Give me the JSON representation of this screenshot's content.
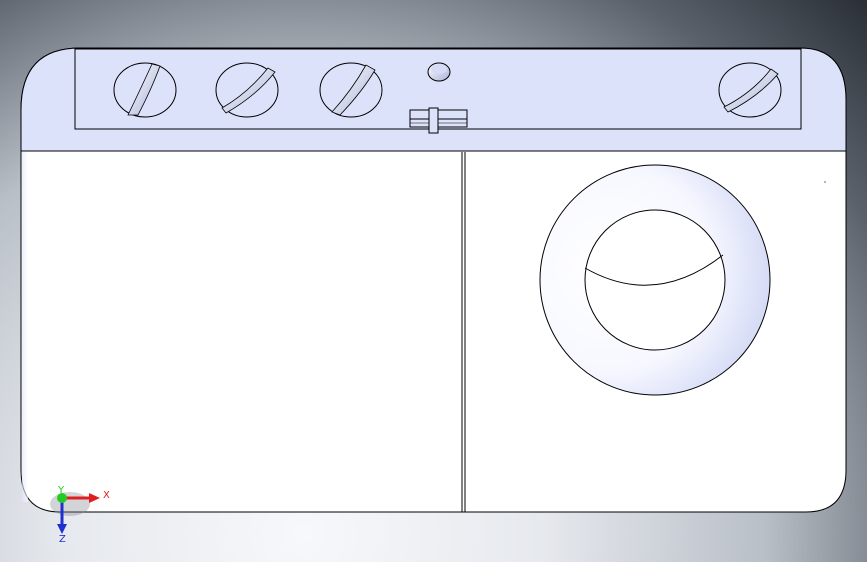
{
  "viewport": {
    "colors": {
      "model_fill": "#ffffff",
      "panel_fill": "#dde2fb",
      "edge": "#000000",
      "shading": "#c8cff5"
    }
  },
  "triad": {
    "x_label": "X",
    "y_label": "Y",
    "z_label": "Z",
    "colors": {
      "x": "#e02020",
      "y": "#22cc22",
      "z": "#2030d0"
    }
  }
}
